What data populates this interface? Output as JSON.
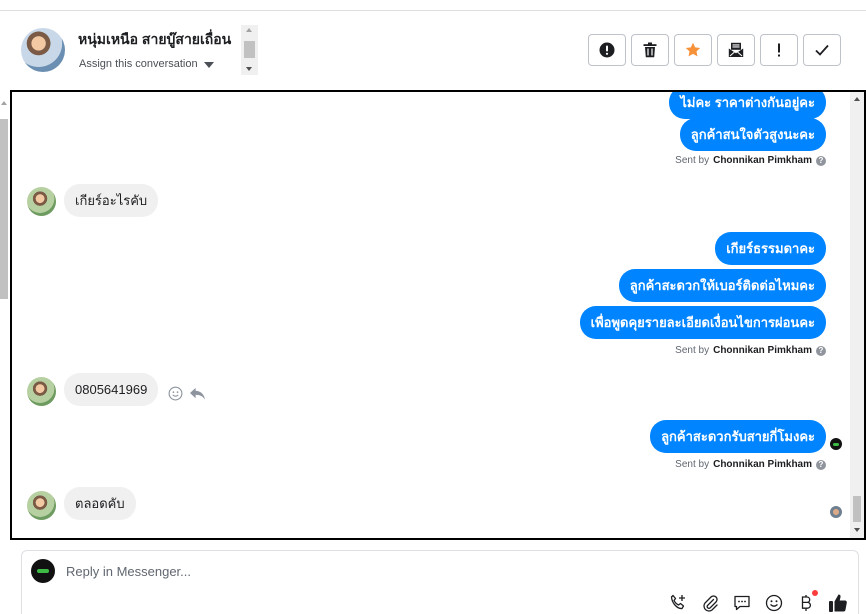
{
  "header": {
    "contact_name": "หนุ่มเหนือ สายบู๊สายเถื่อน",
    "assign_label": "Assign this conversation",
    "actions": [
      {
        "name": "spam-button",
        "icon": "exclamation-circle-icon"
      },
      {
        "name": "delete-button",
        "icon": "trash-icon"
      },
      {
        "name": "star-button",
        "icon": "star-icon"
      },
      {
        "name": "archive-button",
        "icon": "mail-archive-icon"
      },
      {
        "name": "follow-up-button",
        "icon": "exclamation-icon"
      },
      {
        "name": "done-button",
        "icon": "checkmark-icon"
      }
    ],
    "star_color": "#f7923b"
  },
  "messages": {
    "out_1": "ไม่คะ ราคาต่างกันอยู่คะ",
    "out_2": "ลูกค้าสนใจตัวสูงนะคะ",
    "sent_by_1": "Sent by",
    "sender_1": "Chonnikan Pimkham",
    "in_1": "เกียร์อะไรคับ",
    "out_3": "เกียร์ธรรมดาคะ",
    "out_4": "ลูกค้าสะดวกให้เบอร์ติดต่อไหมคะ",
    "out_5": "เพื่อพูดคุยรายละเอียดเงื่อนไขการผ่อนคะ",
    "sent_by_2": "Sent by",
    "sender_2": "Chonnikan Pimkham",
    "in_2": "0805641969",
    "out_6": "ลูกค้าสะดวกรับสายกี่โมงคะ",
    "sent_by_3": "Sent by",
    "sender_3": "Chonnikan Pimkham",
    "in_3": "ตลอดคับ"
  },
  "colors": {
    "outgoing_bubble": "#0084ff",
    "incoming_bubble": "#f1f0f0"
  },
  "composer": {
    "placeholder": "Reply in Messenger...",
    "icons": [
      "phone-add-icon",
      "paperclip-icon",
      "saved-reply-icon",
      "emoji-icon",
      "baht-payment-icon",
      "thumbs-up-icon"
    ]
  }
}
